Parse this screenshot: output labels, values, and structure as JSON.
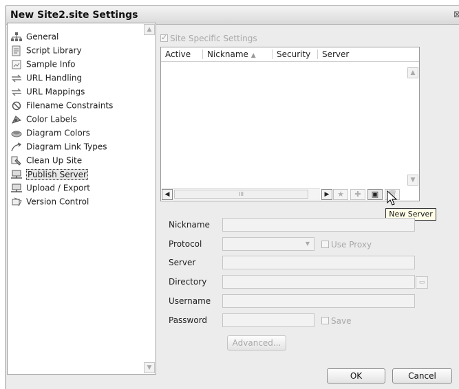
{
  "window": {
    "title": "New Site2.site Settings"
  },
  "categories": [
    {
      "label": "General",
      "icon": "sitemap-icon"
    },
    {
      "label": "Script Library",
      "icon": "script-icon"
    },
    {
      "label": "Sample Info",
      "icon": "page-icon"
    },
    {
      "label": "URL Handling",
      "icon": "arrows-icon"
    },
    {
      "label": "URL Mappings",
      "icon": "arrows-icon"
    },
    {
      "label": "Filename Constraints",
      "icon": "no-entry-icon"
    },
    {
      "label": "Color Labels",
      "icon": "palette-icon"
    },
    {
      "label": "Diagram Colors",
      "icon": "paint-icon"
    },
    {
      "label": "Diagram Link Types",
      "icon": "link-arrow-icon"
    },
    {
      "label": "Clean Up Site",
      "icon": "broom-icon"
    },
    {
      "label": "Publish Server",
      "icon": "server-icon",
      "selected": true
    },
    {
      "label": "Upload / Export",
      "icon": "upload-icon"
    },
    {
      "label": "Version Control",
      "icon": "version-icon"
    }
  ],
  "site_specific": {
    "label": "Site Specific Settings",
    "checked": true
  },
  "table": {
    "columns": [
      "Active",
      "Nickname",
      "Security",
      "Server"
    ],
    "scroll_thumb_label": "III"
  },
  "tooltip": "New Server",
  "form": {
    "nickname_label": "Nickname",
    "protocol_label": "Protocol",
    "use_proxy_label": "Use Proxy",
    "server_label": "Server",
    "directory_label": "Directory",
    "username_label": "Username",
    "password_label": "Password",
    "save_label": "Save",
    "advanced_label": "Advanced..."
  },
  "buttons": {
    "ok": "OK",
    "cancel": "Cancel"
  }
}
